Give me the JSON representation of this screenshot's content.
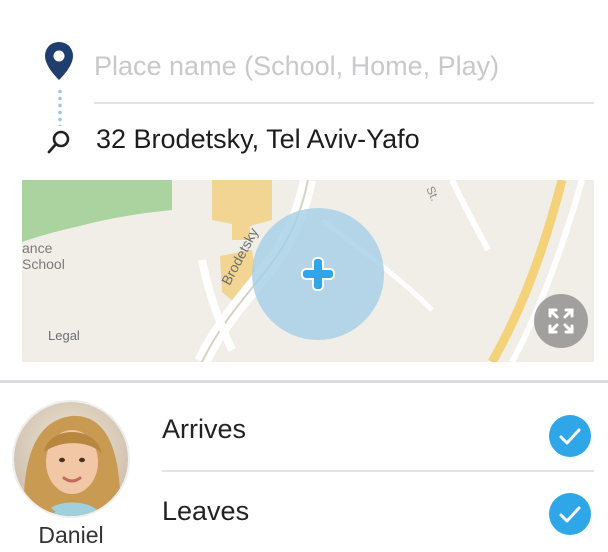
{
  "place": {
    "placeholder": "Place name (School, Home, Play)",
    "value": "",
    "icon": "map-pin-icon"
  },
  "address": {
    "icon": "search-icon",
    "text": "32 Brodetsky, Tel Aviv-Yafo"
  },
  "map": {
    "legal": "Legal",
    "poi_label": "ance\nSchool",
    "street_label": "Brodetsky",
    "street_label_2": "St.",
    "center_icon": "plus-icon",
    "expand_icon": "expand-icon"
  },
  "person": {
    "name": "Daniel"
  },
  "options": [
    {
      "label": "Arrives",
      "checked": true
    },
    {
      "label": "Leaves",
      "checked": true
    }
  ],
  "colors": {
    "accent": "#2fa6e8",
    "pin": "#1f3e6e",
    "placeholder": "#c9c9cc",
    "map_land": "#f1eee8",
    "map_park": "#aad3a0",
    "map_building": "#f2d493",
    "geofence": "#a6cfe6"
  }
}
